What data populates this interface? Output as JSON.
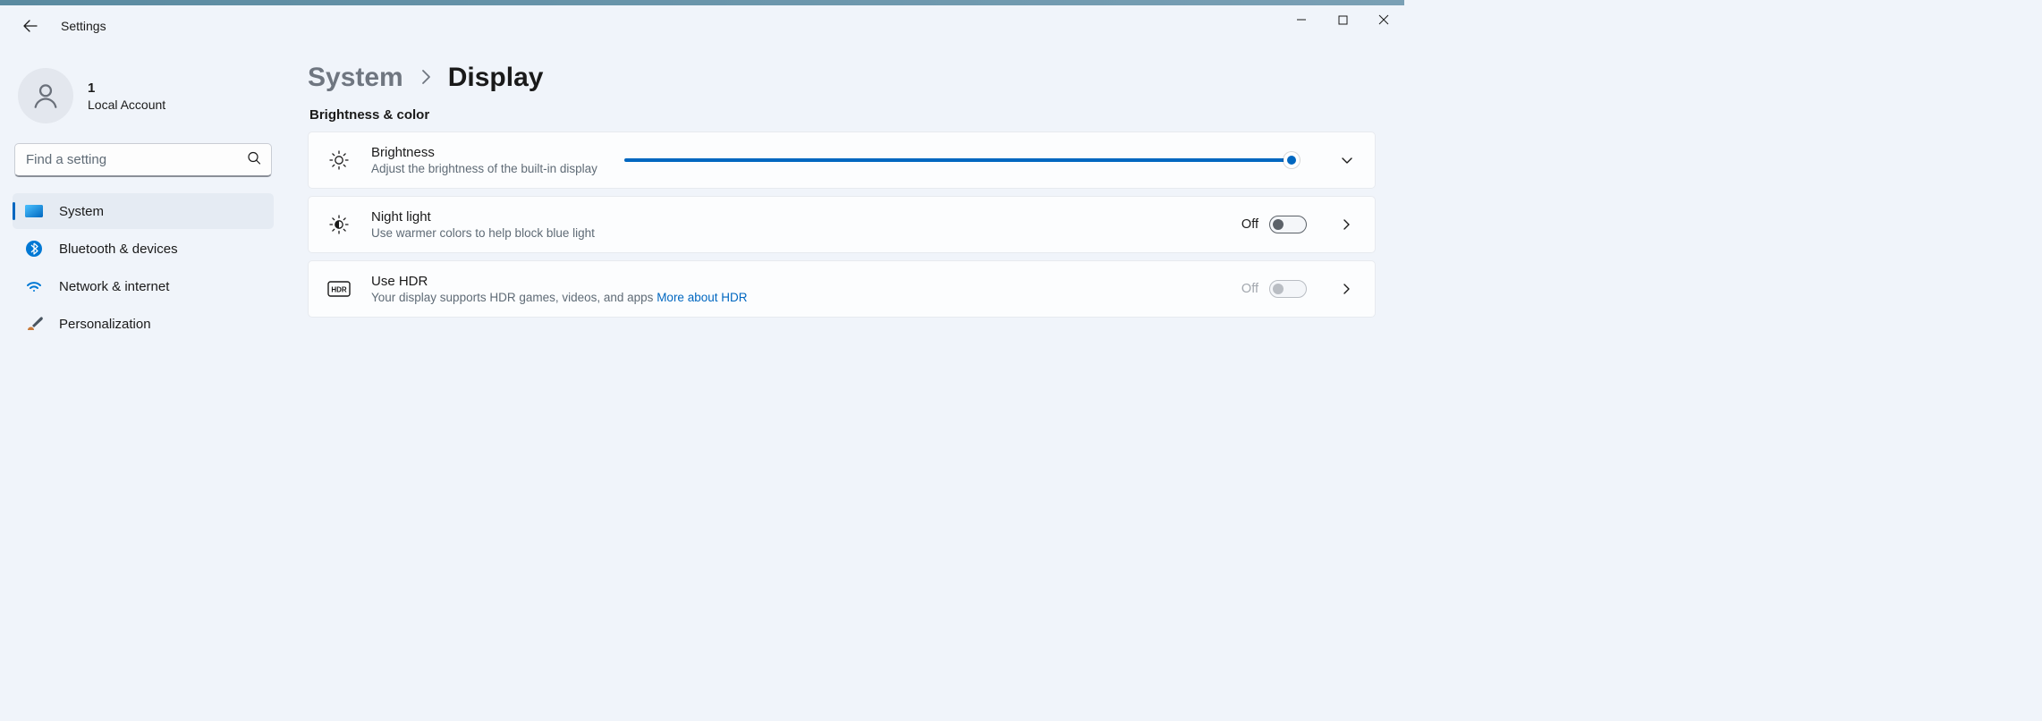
{
  "app_title": "Settings",
  "profile": {
    "name": "1",
    "subtitle": "Local Account"
  },
  "search": {
    "placeholder": "Find a setting"
  },
  "sidebar": {
    "items": [
      {
        "label": "System"
      },
      {
        "label": "Bluetooth & devices"
      },
      {
        "label": "Network & internet"
      },
      {
        "label": "Personalization"
      }
    ]
  },
  "breadcrumb": {
    "parent": "System",
    "current": "Display"
  },
  "section_title": "Brightness & color",
  "cards": {
    "brightness": {
      "title": "Brightness",
      "subtitle": "Adjust the brightness of the built-in display",
      "value_percent": 100
    },
    "nightlight": {
      "title": "Night light",
      "subtitle": "Use warmer colors to help block blue light",
      "state_label": "Off"
    },
    "hdr": {
      "title": "Use HDR",
      "subtitle_prefix": "Your display supports HDR games, videos, and apps  ",
      "link_text": "More about HDR",
      "state_label": "Off"
    }
  }
}
